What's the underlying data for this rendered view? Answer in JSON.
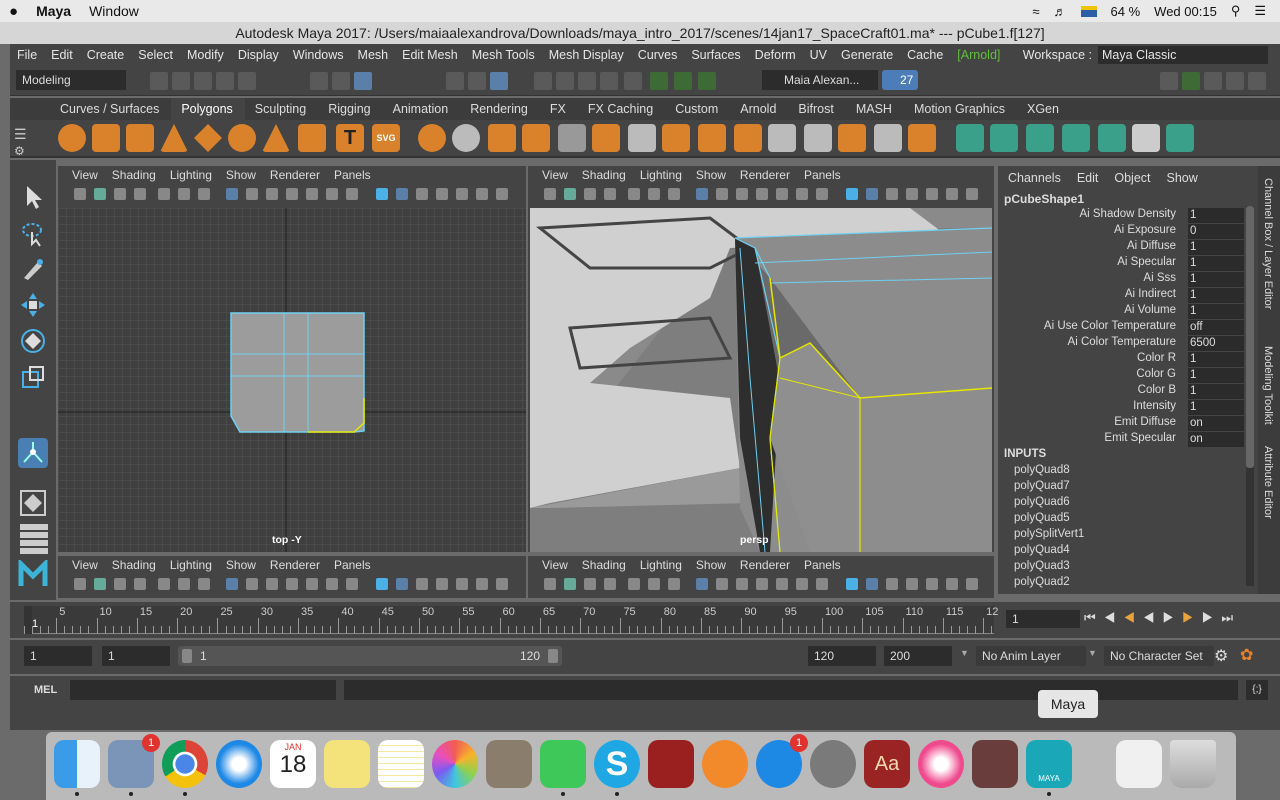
{
  "menubar": {
    "apple": "",
    "app": "Maya",
    "window": "Window",
    "battery": "64 %",
    "clock": "Wed 00:15"
  },
  "titlebar": {
    "title": "Autodesk Maya 2017: /Users/maiaalexandrova/Downloads/maya_intro_2017/scenes/14jan17_SpaceCraft01.ma*   ---   pCube1.f[127]"
  },
  "mainmenu": {
    "items": [
      "File",
      "Edit",
      "Create",
      "Select",
      "Modify",
      "Display",
      "Windows",
      "Mesh",
      "Edit Mesh",
      "Mesh Tools",
      "Mesh Display",
      "Curves",
      "Surfaces",
      "Deform",
      "UV",
      "Generate",
      "Cache"
    ],
    "arnold": "[Arnold]",
    "workspace_label": "Workspace :",
    "workspace_value": "Maya Classic"
  },
  "statusline": {
    "mode": "Modeling",
    "user": "Maia Alexan...",
    "notify": "27"
  },
  "shelf": {
    "tabs": [
      "Curves / Surfaces",
      "Polygons",
      "Sculpting",
      "Rigging",
      "Animation",
      "Rendering",
      "FX",
      "FX Caching",
      "Custom",
      "Arnold",
      "Bifrost",
      "MASH",
      "Motion Graphics",
      "XGen"
    ],
    "active": "Polygons"
  },
  "viewport_menu": [
    "View",
    "Shading",
    "Lighting",
    "Show",
    "Renderer",
    "Panels"
  ],
  "viewports": {
    "top_label": "top -Y",
    "persp_label": "persp"
  },
  "channel": {
    "menu": [
      "Channels",
      "Edit",
      "Object",
      "Show"
    ],
    "shape": "pCubeShape1",
    "attrs": [
      {
        "n": "Ai Shadow Density",
        "v": "1"
      },
      {
        "n": "Ai Exposure",
        "v": "0"
      },
      {
        "n": "Ai Diffuse",
        "v": "1"
      },
      {
        "n": "Ai Specular",
        "v": "1"
      },
      {
        "n": "Ai Sss",
        "v": "1"
      },
      {
        "n": "Ai Indirect",
        "v": "1"
      },
      {
        "n": "Ai Volume",
        "v": "1"
      },
      {
        "n": "Ai Use Color Temperature",
        "v": "off"
      },
      {
        "n": "Ai Color Temperature",
        "v": "6500"
      },
      {
        "n": "Color R",
        "v": "1"
      },
      {
        "n": "Color G",
        "v": "1"
      },
      {
        "n": "Color B",
        "v": "1"
      },
      {
        "n": "Intensity",
        "v": "1"
      },
      {
        "n": "Emit Diffuse",
        "v": "on"
      },
      {
        "n": "Emit Specular",
        "v": "on"
      }
    ],
    "inputs_label": "INPUTS",
    "inputs": [
      "polyQuad8",
      "polyQuad7",
      "polyQuad6",
      "polyQuad5",
      "polySplitVert1",
      "polyQuad4",
      "polyQuad3",
      "polyQuad2"
    ]
  },
  "sidetabs": [
    "Channel Box / Layer Editor",
    "Modeling Toolkit",
    "Attribute Editor"
  ],
  "timeline": {
    "ticks": [
      "5",
      "10",
      "15",
      "20",
      "25",
      "30",
      "35",
      "40",
      "45",
      "50",
      "55",
      "60",
      "65",
      "70",
      "75",
      "80",
      "85",
      "90",
      "95",
      "100",
      "105",
      "110",
      "115",
      "12"
    ],
    "current": "1",
    "start_tick": "1"
  },
  "range": {
    "start": "1",
    "playstart": "1",
    "slider_start": "1",
    "slider_end": "120",
    "playend": "120",
    "end": "200",
    "anim_layer": "No Anim Layer",
    "char_set": "No Character Set"
  },
  "cmdline": {
    "label": "MEL"
  },
  "dock": {
    "tooltip": "Maya",
    "mail_badge": "1",
    "appstore_badge": "1",
    "calendar_month": "JAN",
    "calendar_day": "18",
    "maya_label": "MAYA"
  }
}
